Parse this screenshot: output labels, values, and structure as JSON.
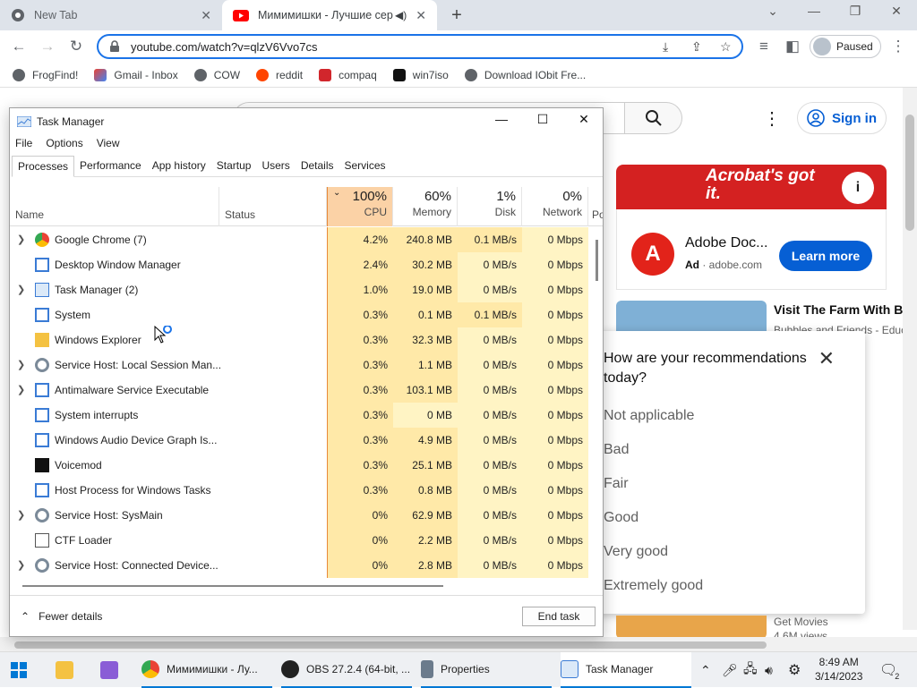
{
  "browser": {
    "tabs": [
      {
        "title": "New Tab",
        "close": "✕"
      },
      {
        "title": "Мимимишки - Лучшие сер",
        "close": "✕"
      }
    ],
    "url": "youtube.com/watch?v=qlzV6Vvo7cs",
    "profile_label": "Paused",
    "bookmarks": [
      "FrogFind!",
      "Gmail - Inbox",
      "COW",
      "reddit",
      "compaq",
      "win7iso",
      "Download IObit Fre..."
    ]
  },
  "youtube": {
    "sign_in": "Sign in",
    "ad": {
      "banner": "Acrobat's got it.",
      "title": "Adobe Doc...",
      "badge": "Ad",
      "domain": "adobe.com",
      "cta": "Learn more",
      "logo_letter": "A"
    },
    "video": {
      "title": "Visit The Farm With Bu",
      "channel": "Bubbles and Friends - Educ"
    },
    "survey": {
      "question": "How are your recommendations today?",
      "options": [
        "Not applicable",
        "Bad",
        "Fair",
        "Good",
        "Very good",
        "Extremely good"
      ]
    },
    "bottom_video": {
      "title": "Get Movies",
      "views": "4.6M views"
    }
  },
  "task_manager": {
    "title": "Task Manager",
    "menu": [
      "File",
      "Options",
      "View"
    ],
    "tabs": [
      "Processes",
      "Performance",
      "App history",
      "Startup",
      "Users",
      "Details",
      "Services"
    ],
    "columns": {
      "name": "Name",
      "status": "Status",
      "cpu": {
        "pct": "100%",
        "label": "CPU"
      },
      "memory": {
        "pct": "60%",
        "label": "Memory"
      },
      "disk": {
        "pct": "1%",
        "label": "Disk"
      },
      "network": {
        "pct": "0%",
        "label": "Network"
      },
      "power": "Po"
    },
    "processes": [
      {
        "name": "Google Chrome (7)",
        "expandable": true,
        "icon": "chrome-icon",
        "cpu": "4.2%",
        "memory": "240.8 MB",
        "disk": "0.1 MB/s",
        "network": "0 Mbps"
      },
      {
        "name": "Desktop Window Manager",
        "expandable": false,
        "icon": "window-icon",
        "cpu": "2.4%",
        "memory": "30.2 MB",
        "disk": "0 MB/s",
        "network": "0 Mbps"
      },
      {
        "name": "Task Manager (2)",
        "expandable": true,
        "icon": "taskmanager-icon",
        "cpu": "1.0%",
        "memory": "19.0 MB",
        "disk": "0 MB/s",
        "network": "0 Mbps"
      },
      {
        "name": "System",
        "expandable": false,
        "icon": "window-icon",
        "cpu": "0.3%",
        "memory": "0.1 MB",
        "disk": "0.1 MB/s",
        "network": "0 Mbps"
      },
      {
        "name": "Windows Explorer",
        "expandable": false,
        "icon": "folder-icon",
        "cpu": "0.3%",
        "memory": "32.3 MB",
        "disk": "0 MB/s",
        "network": "0 Mbps"
      },
      {
        "name": "Service Host: Local Session Man...",
        "expandable": true,
        "icon": "gear-icon",
        "cpu": "0.3%",
        "memory": "1.1 MB",
        "disk": "0 MB/s",
        "network": "0 Mbps"
      },
      {
        "name": "Antimalware Service Executable",
        "expandable": true,
        "icon": "window-icon",
        "cpu": "0.3%",
        "memory": "103.1 MB",
        "disk": "0 MB/s",
        "network": "0 Mbps"
      },
      {
        "name": "System interrupts",
        "expandable": false,
        "icon": "window-icon",
        "cpu": "0.3%",
        "memory": "0 MB",
        "disk": "0 MB/s",
        "network": "0 Mbps"
      },
      {
        "name": "Windows Audio Device Graph Is...",
        "expandable": false,
        "icon": "window-icon",
        "cpu": "0.3%",
        "memory": "4.9 MB",
        "disk": "0 MB/s",
        "network": "0 Mbps"
      },
      {
        "name": "Voicemod",
        "expandable": false,
        "icon": "voicemod-icon",
        "cpu": "0.3%",
        "memory": "25.1 MB",
        "disk": "0 MB/s",
        "network": "0 Mbps"
      },
      {
        "name": "Host Process for Windows Tasks",
        "expandable": false,
        "icon": "window-icon",
        "cpu": "0.3%",
        "memory": "0.8 MB",
        "disk": "0 MB/s",
        "network": "0 Mbps"
      },
      {
        "name": "Service Host: SysMain",
        "expandable": true,
        "icon": "gear-icon",
        "cpu": "0%",
        "memory": "62.9 MB",
        "disk": "0 MB/s",
        "network": "0 Mbps"
      },
      {
        "name": "CTF Loader",
        "expandable": false,
        "icon": "pen-icon",
        "cpu": "0%",
        "memory": "2.2 MB",
        "disk": "0 MB/s",
        "network": "0 Mbps"
      },
      {
        "name": "Service Host: Connected Device...",
        "expandable": true,
        "icon": "gear-icon",
        "cpu": "0%",
        "memory": "2.8 MB",
        "disk": "0 MB/s",
        "network": "0 Mbps"
      }
    ],
    "fewer_details": "Fewer details",
    "end_task": "End task"
  },
  "taskbar": {
    "apps": [
      {
        "label": "Мимимишки - Лу...",
        "icon": "chrome-icon",
        "color": "#4285f4"
      },
      {
        "label": "OBS 27.2.4 (64-bit, ...",
        "icon": "obs-icon",
        "color": "#222222"
      },
      {
        "label": "Properties",
        "icon": "properties-icon",
        "color": "#6b7b8c"
      },
      {
        "label": "Task Manager",
        "icon": "taskmanager-icon",
        "color": "#3a7bd5"
      }
    ],
    "time": "8:49 AM",
    "date": "3/14/2023",
    "notification_count": "2"
  },
  "colors": {
    "accent": "#1a73e8",
    "cpu_heat": "#fbd2a6",
    "heat_light": "#fff4c4",
    "heat_mid": "#ffe9a8",
    "yt_blue": "#065fd4",
    "adobe_red": "#d42121"
  }
}
